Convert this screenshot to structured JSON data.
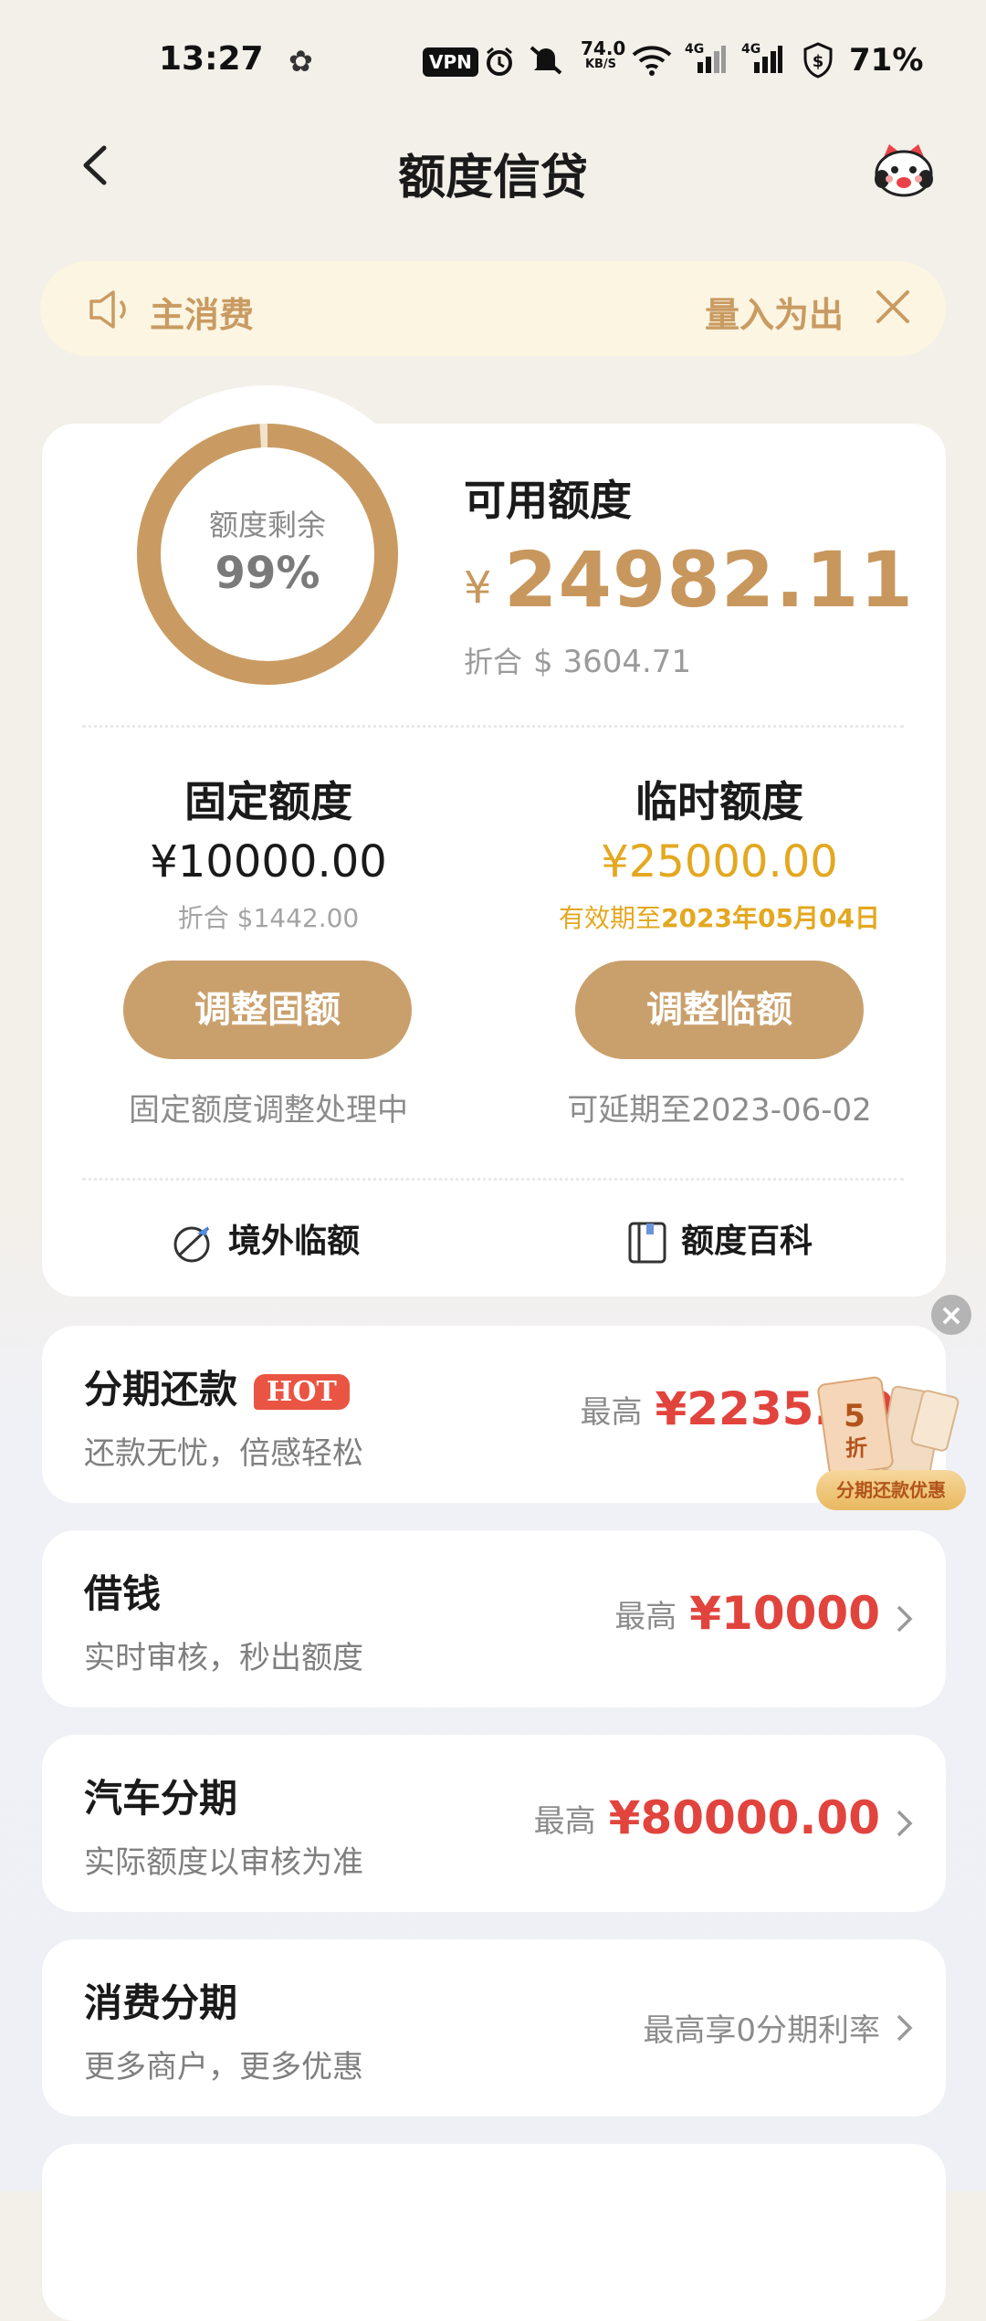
{
  "status_bar": {
    "time": "13:27",
    "vpn": "VPN",
    "net_speed_value": "74.0",
    "net_speed_unit": "KB/S",
    "signal1": "4G",
    "signal2": "4G",
    "battery": "71%"
  },
  "header": {
    "title": "额度信贷"
  },
  "notice": {
    "text_left": "主消费",
    "text_right": "量入为出"
  },
  "credit": {
    "ring_label": "额度剩余",
    "ring_percent": "99%",
    "ring_fraction": 0.99,
    "available_title": "可用额度",
    "available_currency": "¥",
    "available_amount": "24982.11",
    "converted_label": "折合",
    "converted_amount": "$ 3604.71",
    "fixed": {
      "title": "固定额度",
      "amount": "¥10000.00",
      "converted": "折合 $1442.00",
      "button": "调整固额",
      "note": "固定额度调整处理中"
    },
    "temporary": {
      "title": "临时额度",
      "amount": "¥25000.00",
      "validity_prefix": "有效期至",
      "validity_date": "2023年05月04日",
      "button": "调整临额",
      "note": "可延期至2023-06-02"
    },
    "links": {
      "overseas": "境外临额",
      "encyclopedia": "额度百科"
    }
  },
  "services": [
    {
      "name": "分期还款",
      "badge": "HOT",
      "desc": "还款无忧，倍感轻松",
      "prefix": "最高",
      "value": "¥2235.00"
    },
    {
      "name": "借钱",
      "desc": "实时审核，秒出额度",
      "prefix": "最高",
      "value": "¥10000"
    },
    {
      "name": "汽车分期",
      "desc": "实际额度以审核为准",
      "prefix": "最高",
      "value": "¥80000.00"
    },
    {
      "name": "消费分期",
      "desc": "更多商户，更多优惠",
      "text": "最高享0分期利率"
    }
  ],
  "promo": {
    "number": "5",
    "unit": "折",
    "label": "分期还款优惠"
  },
  "colors": {
    "gold": "#c9a06c",
    "temporary_gold": "#e3a820",
    "red": "#e1443d",
    "hot_badge": "#ea5443"
  }
}
